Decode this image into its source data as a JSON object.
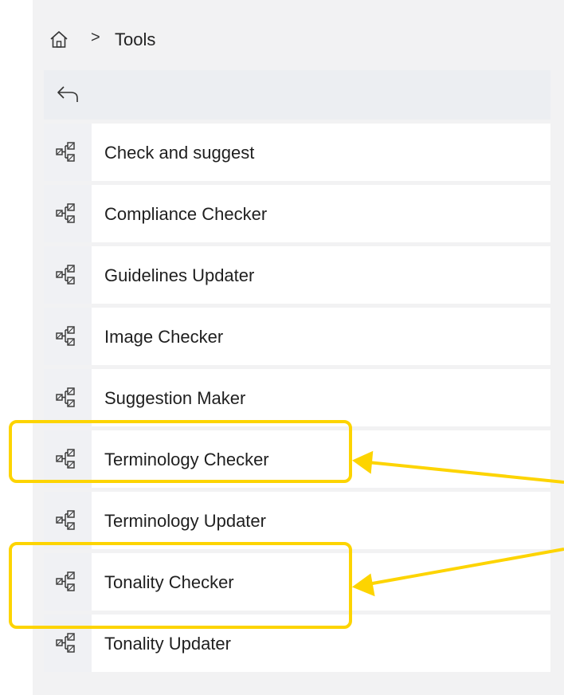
{
  "breadcrumb": {
    "home_icon": "home-icon",
    "separator": ">",
    "label": "Tools"
  },
  "back": {
    "icon": "back-arrow-icon"
  },
  "tools": [
    {
      "label": "Check and suggest",
      "icon": "workflow-icon"
    },
    {
      "label": "Compliance Checker",
      "icon": "workflow-icon"
    },
    {
      "label": "Guidelines Updater",
      "icon": "workflow-icon"
    },
    {
      "label": "Image Checker",
      "icon": "workflow-icon"
    },
    {
      "label": "Suggestion Maker",
      "icon": "workflow-icon"
    },
    {
      "label": "Terminology Checker",
      "icon": "workflow-icon"
    },
    {
      "label": "Terminology Updater",
      "icon": "workflow-icon"
    },
    {
      "label": "Tonality Checker",
      "icon": "workflow-icon"
    },
    {
      "label": "Tonality Updater",
      "icon": "workflow-icon"
    }
  ],
  "annotation": {
    "highlight_color": "#fdd400",
    "highlighted_items": [
      "Terminology Checker",
      "Tonality Checker"
    ]
  },
  "colors": {
    "panel_bg": "#f2f2f3",
    "item_bg": "#ffffff",
    "icon_box_bg": "#f0f1f4",
    "text": "#1f1f1f"
  }
}
